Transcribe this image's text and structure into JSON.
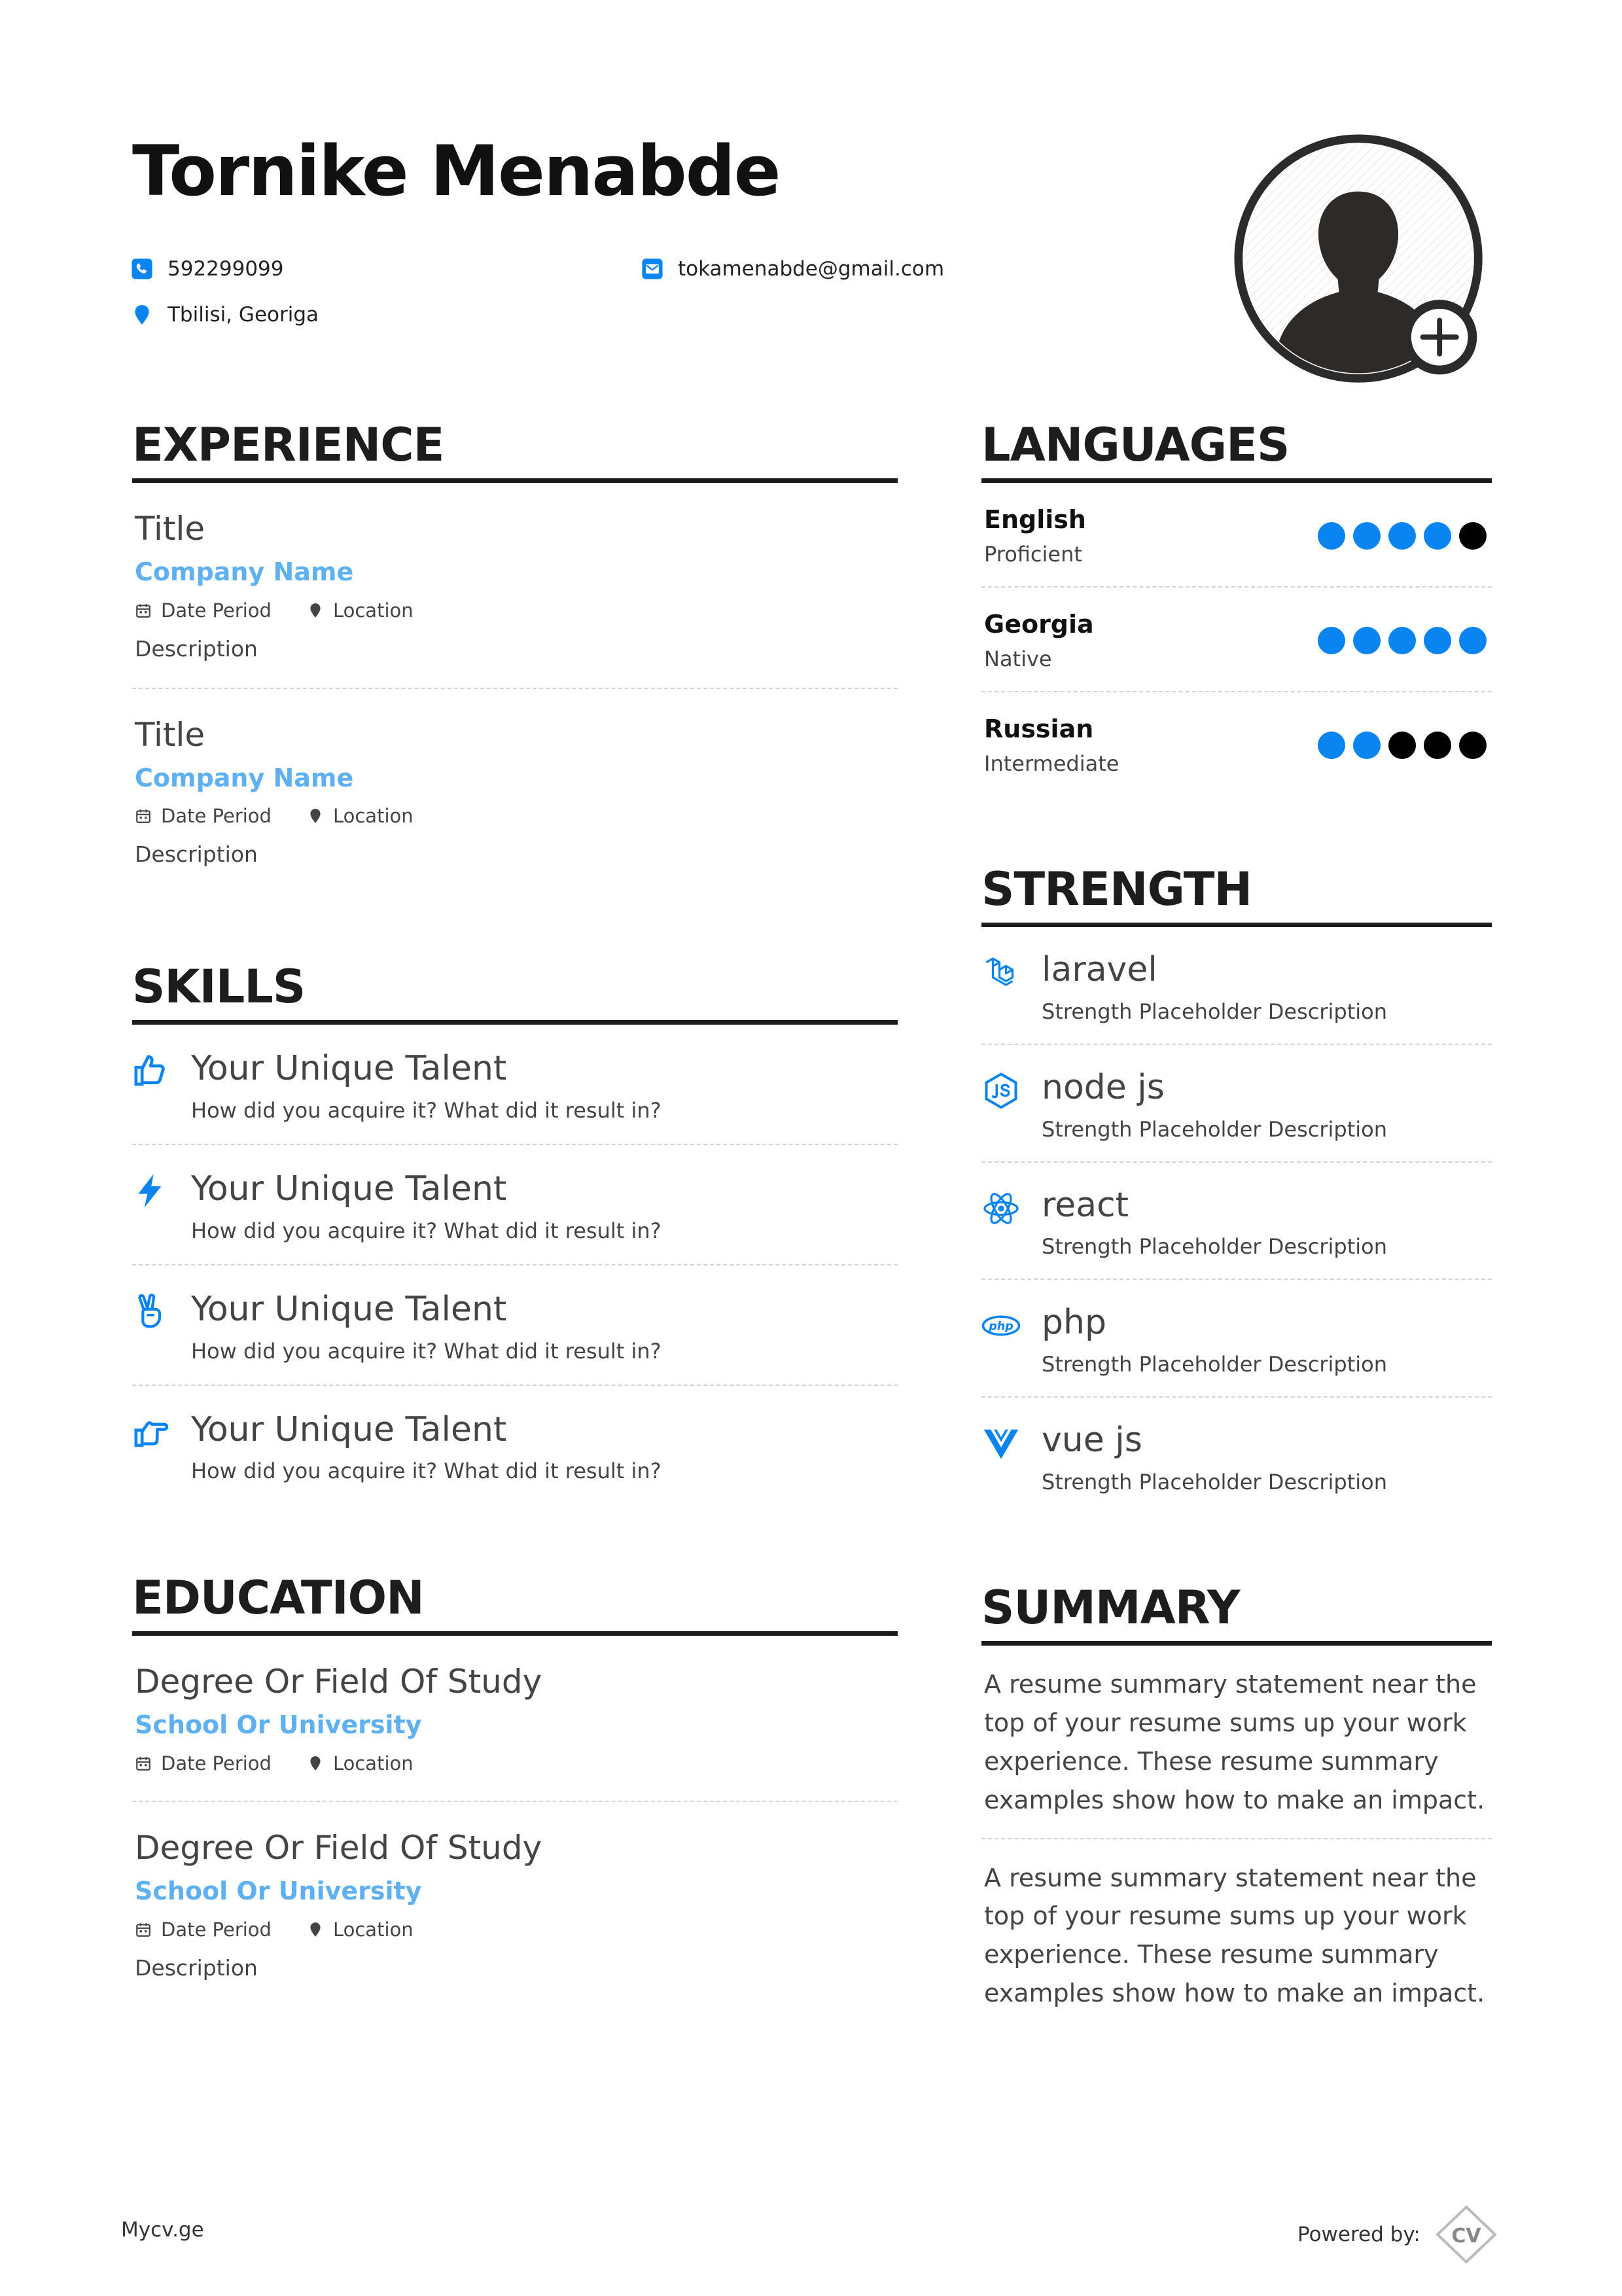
{
  "header": {
    "name": "Tornike Menabde",
    "phone": "592299099",
    "email": "tokamenabde@gmail.com",
    "location": "Tbilisi, Georiga",
    "phone_icon": "phone-icon",
    "email_icon": "email-icon",
    "location_icon": "map-pin-icon"
  },
  "experience": {
    "title": "EXPERIENCE",
    "items": [
      {
        "title": "Title",
        "company": "Company Name",
        "date": "Date Period",
        "location": "Location",
        "description": "Description"
      },
      {
        "title": "Title",
        "company": "Company Name",
        "date": "Date Period",
        "location": "Location",
        "description": "Description"
      }
    ]
  },
  "skills": {
    "title": "SKILLS",
    "items": [
      {
        "icon": "thumbs-up-icon",
        "title": "Your Unique Talent",
        "description": "How did you acquire it? What did it result in?"
      },
      {
        "icon": "lightning-bolt-icon",
        "title": "Your Unique Talent",
        "description": "How did you acquire it? What did it result in?"
      },
      {
        "icon": "peace-hand-icon",
        "title": "Your Unique Talent",
        "description": "How did you acquire it? What did it result in?"
      },
      {
        "icon": "hand-pointing-right-icon",
        "title": "Your Unique Talent",
        "description": "How did you acquire it? What did it result in?"
      }
    ]
  },
  "education": {
    "title": "EDUCATION",
    "items": [
      {
        "degree": "Degree Or Field Of Study",
        "school": "School Or University",
        "date": "Date Period",
        "location": "Location"
      },
      {
        "degree": "Degree Or Field Of Study",
        "school": "School Or University",
        "date": "Date Period",
        "location": "Location",
        "description": "Description"
      }
    ]
  },
  "languages": {
    "title": "LANGUAGES",
    "items": [
      {
        "name": "English",
        "level": "Proficient",
        "rating": 4,
        "max": 5
      },
      {
        "name": "Georgia",
        "level": "Native",
        "rating": 5,
        "max": 5
      },
      {
        "name": "Russian",
        "level": "Intermediate",
        "rating": 2,
        "max": 5
      }
    ]
  },
  "strength": {
    "title": "STRENGTH",
    "items": [
      {
        "icon": "laravel-icon",
        "title": "laravel",
        "description": "Strength Placeholder Description"
      },
      {
        "icon": "nodejs-icon",
        "title": "node js",
        "description": "Strength Placeholder Description"
      },
      {
        "icon": "react-icon",
        "title": "react",
        "description": "Strength Placeholder Description"
      },
      {
        "icon": "php-icon",
        "title": "php",
        "description": "Strength Placeholder Description"
      },
      {
        "icon": "vuejs-icon",
        "title": "vue js",
        "description": "Strength Placeholder Description"
      }
    ]
  },
  "summary": {
    "title": "SUMMARY",
    "paragraphs": [
      "A resume summary statement near the top of your resume sums up your work experience. These resume summary examples show how to make an impact.",
      "A resume summary statement near the top of your resume sums up your work experience. These resume summary examples show how to make an impact."
    ]
  },
  "footer": {
    "left": "Mycv.ge",
    "powered_by": "Powered by:",
    "logo_text": "CV"
  },
  "colors": {
    "accent": "#0a84f0",
    "company": "#5eb0f0",
    "heading": "#1b1b1b"
  }
}
